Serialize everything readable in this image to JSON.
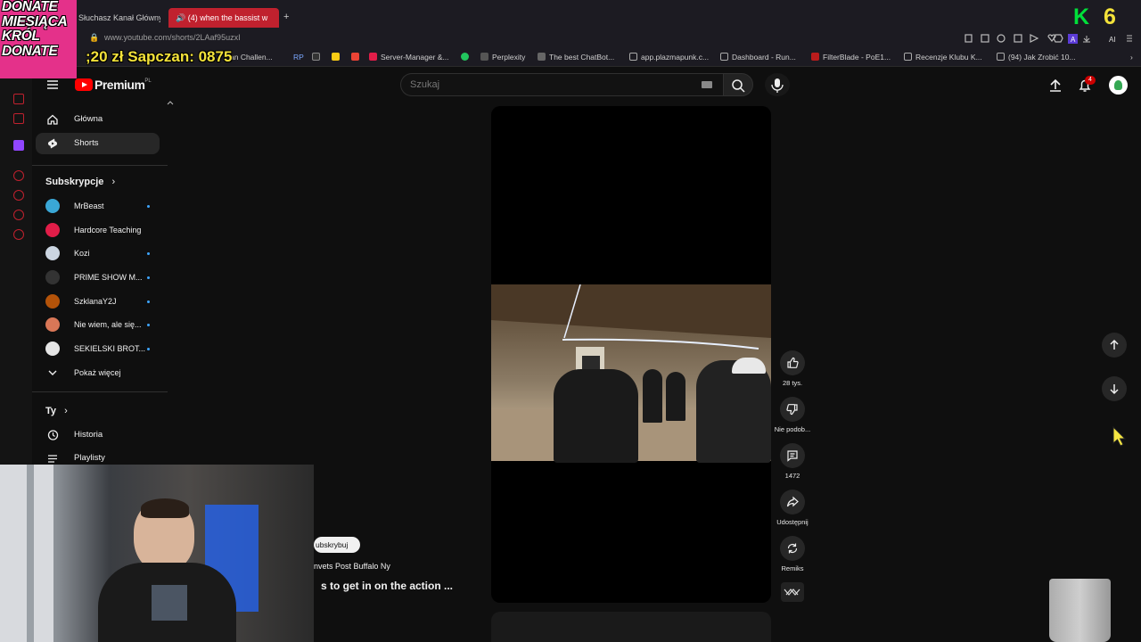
{
  "overlay": {
    "donate_lines": [
      "DONATE",
      "MIESIĄCA",
      "KRÓL",
      "DONATE"
    ],
    "goal_text": ";20 zł Sapczan: 0875",
    "k_badge": "K",
    "k_count": "6"
  },
  "browser": {
    "tabs": [
      {
        "label": "Słuchasz Kanał Główny"
      },
      {
        "label": "(4) when the bassist w"
      }
    ],
    "new_tab_label": "+",
    "url": "www.youtube.com/shorts/2LAaf95uzxI",
    "ai_label": "AI",
    "bookmarks": [
      {
        "label": "an Challen...",
        "color": "#444"
      },
      {
        "label": "RP",
        "color": "#3b82f6"
      },
      {
        "label": "S",
        "color": "#333"
      },
      {
        "label": "",
        "color": "#facc15"
      },
      {
        "label": "M",
        "color": "#ea4335"
      },
      {
        "label": "Server-Manager &...",
        "color": "#e11d48"
      },
      {
        "label": "",
        "color": "#22c55e"
      },
      {
        "label": "Perplexity",
        "color": "#555"
      },
      {
        "label": "The best ChatBot...",
        "color": "#555"
      },
      {
        "label": "app.plazmapunk.c...",
        "color": "#555"
      },
      {
        "label": "Dashboard - Run...",
        "color": "#555"
      },
      {
        "label": "FilterBlade - PoE1...",
        "color": "#b91c1c"
      },
      {
        "label": "Recenzje Klubu K...",
        "color": "#555"
      },
      {
        "label": "(94) Jak Zrobić 10...",
        "color": "#555"
      }
    ]
  },
  "youtube": {
    "logo_text": "Premium",
    "logo_region": "PL",
    "search_placeholder": "Szukaj",
    "notif_count": "4",
    "nav": [
      {
        "label": "Główna"
      },
      {
        "label": "Shorts"
      }
    ],
    "subs_header": "Subskrypcje",
    "subscriptions": [
      {
        "name": "MrBeast",
        "color": "#3aa7d6"
      },
      {
        "name": "Hardcore Teaching",
        "color": "#e11d48"
      },
      {
        "name": "Kozi",
        "color": "#cbd5e1"
      },
      {
        "name": "PRIME SHOW M...",
        "color": "#333"
      },
      {
        "name": "SzklanaY2J",
        "color": "#b45309"
      },
      {
        "name": "Nie wiem, ale się...",
        "color": "#d97757"
      },
      {
        "name": "SEKIELSKI BROT...",
        "color": "#e5e5e5"
      }
    ],
    "show_more": "Pokaż więcej",
    "you_header": "Ty",
    "you_items": [
      {
        "label": "Historia"
      },
      {
        "label": "Playlisty"
      }
    ]
  },
  "short": {
    "like_count": "28 tys.",
    "dislike_label": "Nie podob...",
    "comment_count": "1472",
    "share_label": "Udostępnij",
    "remix_label": "Remiks",
    "subscribe_label": "ubskrybuj",
    "channel_name": "nvets Post Buffalo Ny",
    "title": "s to get in on the action ..."
  }
}
